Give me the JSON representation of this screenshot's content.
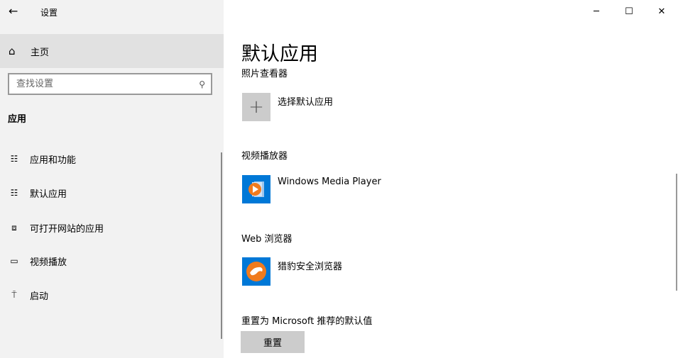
{
  "window": {
    "title": "设置",
    "minimize": "─",
    "maximize": "☐",
    "close": "✕"
  },
  "sidebar": {
    "back": "←",
    "home": "主页",
    "search_placeholder": "查找设置",
    "section": "应用",
    "items": [
      {
        "label": "应用和功能",
        "icon": "☷"
      },
      {
        "label": "默认应用",
        "icon": "☷"
      },
      {
        "label": "可打开网站的应用",
        "icon": "⧈"
      },
      {
        "label": "视频播放",
        "icon": "▭"
      },
      {
        "label": "启动",
        "icon": "⍑"
      }
    ]
  },
  "main": {
    "title": "默认应用",
    "photo_label": "照片查看器",
    "photo_app": "选择默认应用",
    "video_label": "视频播放器",
    "video_app": "Windows Media Player",
    "web_label": "Web 浏览器",
    "web_app": "猎豹安全浏览器",
    "reset_label": "重置为 Microsoft 推荐的默认值",
    "reset_button": "重置"
  },
  "colors": {
    "accent": "#0078d7",
    "sidebar": "#f2f2f2"
  }
}
